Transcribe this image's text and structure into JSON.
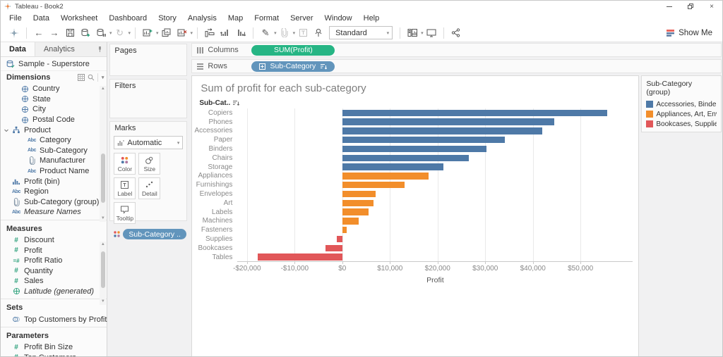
{
  "window": {
    "title": "Tableau - Book2"
  },
  "menu": {
    "items": [
      "File",
      "Data",
      "Worksheet",
      "Dashboard",
      "Story",
      "Analysis",
      "Map",
      "Format",
      "Server",
      "Window",
      "Help"
    ]
  },
  "toolbar": {
    "fit_label": "Standard",
    "show_me_label": "Show Me"
  },
  "data_pane": {
    "tabs": {
      "data": "Data",
      "analytics": "Analytics"
    },
    "datasource": "Sample - Superstore",
    "dimensions": {
      "header": "Dimensions",
      "items": [
        {
          "label": "Country",
          "icon": "globe",
          "indent": 2
        },
        {
          "label": "State",
          "icon": "globe",
          "indent": 2
        },
        {
          "label": "City",
          "icon": "globe",
          "indent": 2
        },
        {
          "label": "Postal Code",
          "icon": "globe",
          "indent": 2
        },
        {
          "label": "Product",
          "icon": "hierarchy",
          "indent": 1,
          "expanded": true
        },
        {
          "label": "Category",
          "icon": "abc",
          "indent": 3
        },
        {
          "label": "Sub-Category",
          "icon": "abc",
          "indent": 3
        },
        {
          "label": "Manufacturer",
          "icon": "paperclip",
          "indent": 3
        },
        {
          "label": "Product Name",
          "icon": "abc",
          "indent": 3
        },
        {
          "label": "Profit (bin)",
          "icon": "histogram",
          "indent": 1
        },
        {
          "label": "Region",
          "icon": "abc",
          "indent": 1
        },
        {
          "label": "Sub-Category (group)",
          "icon": "paperclip",
          "indent": 1
        },
        {
          "label": "Measure Names",
          "icon": "abc",
          "indent": 1,
          "italic": true
        }
      ]
    },
    "measures": {
      "header": "Measures",
      "items": [
        {
          "label": "Discount",
          "icon": "hash",
          "indent": 1
        },
        {
          "label": "Profit",
          "icon": "hash",
          "indent": 1
        },
        {
          "label": "Profit Ratio",
          "icon": "calc-hash",
          "indent": 1
        },
        {
          "label": "Quantity",
          "icon": "hash",
          "indent": 1
        },
        {
          "label": "Sales",
          "icon": "hash",
          "indent": 1
        },
        {
          "label": "Latitude (generated)",
          "icon": "globe-green",
          "indent": 1,
          "italic": true
        }
      ]
    },
    "sets": {
      "header": "Sets",
      "items": [
        {
          "label": "Top Customers by Profit",
          "icon": "venn",
          "indent": 1
        }
      ]
    },
    "parameters": {
      "header": "Parameters",
      "items": [
        {
          "label": "Profit Bin Size",
          "icon": "hash",
          "indent": 1
        },
        {
          "label": "Top Customers",
          "icon": "hash",
          "indent": 1
        }
      ]
    }
  },
  "cards": {
    "pages_label": "Pages",
    "filters_label": "Filters",
    "marks": {
      "label": "Marks",
      "mark_type": "Automatic",
      "buttons": [
        {
          "label": "Color",
          "icon": "color-dots"
        },
        {
          "label": "Size",
          "icon": "size-circles"
        },
        {
          "label": "Label",
          "icon": "text-label"
        },
        {
          "label": "Detail",
          "icon": "detail-dots"
        },
        {
          "label": "Tooltip",
          "icon": "tooltip-bubble"
        }
      ],
      "pill": "Sub-Category .."
    }
  },
  "shelves": {
    "columns_label": "Columns",
    "columns_pill": "SUM(Profit)",
    "rows_label": "Rows",
    "rows_pill": "Sub-Category"
  },
  "sheet": {
    "title": "Sum of profit for each sub-category",
    "row_header": "Sub-Cat..",
    "axis_label": "Profit"
  },
  "legend": {
    "title": "Sub-Category (group)",
    "items": [
      {
        "label": "Accessories, Binders..",
        "color": "#4e79a7"
      },
      {
        "label": "Appliances, Art, Env..",
        "color": "#f28e2b"
      },
      {
        "label": "Bookcases, Supplies...",
        "color": "#e15759"
      }
    ]
  },
  "chart_data": {
    "type": "bar",
    "orientation": "horizontal",
    "title": "Sum of profit for each sub-category",
    "xlabel": "Profit",
    "categories": [
      "Copiers",
      "Phones",
      "Accessories",
      "Paper",
      "Binders",
      "Chairs",
      "Storage",
      "Appliances",
      "Furnishings",
      "Envelopes",
      "Art",
      "Labels",
      "Machines",
      "Fasteners",
      "Supplies",
      "Bookcases",
      "Tables"
    ],
    "values": [
      55618,
      44516,
      41937,
      34054,
      30222,
      26590,
      21279,
      18138,
      13059,
      6964,
      6528,
      5546,
      3385,
      950,
      -1189,
      -3473,
      -17725
    ],
    "groups": [
      "blue",
      "blue",
      "blue",
      "blue",
      "blue",
      "blue",
      "blue",
      "orange",
      "orange",
      "orange",
      "orange",
      "orange",
      "orange",
      "orange",
      "red",
      "red",
      "red"
    ],
    "group_colors": {
      "blue": "#4e79a7",
      "orange": "#f28e2b",
      "red": "#e15759"
    },
    "xlim": [
      -22000,
      61000
    ],
    "ticks": [
      -20000,
      -10000,
      0,
      10000,
      20000,
      30000,
      40000,
      50000
    ],
    "tick_labels": [
      "-$20,000",
      "-$10,000",
      "$0",
      "$10,000",
      "$20,000",
      "$30,000",
      "$40,000",
      "$50,000"
    ],
    "grid": true,
    "legend_position": "right"
  }
}
